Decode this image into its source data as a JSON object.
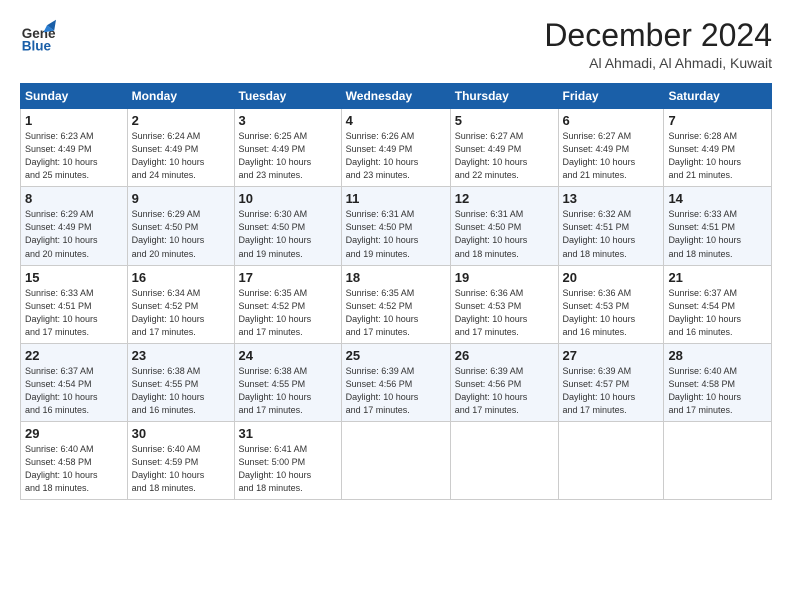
{
  "logo": {
    "line1": "General",
    "line2": "Blue"
  },
  "title": "December 2024",
  "subtitle": "Al Ahmadi, Al Ahmadi, Kuwait",
  "days_of_week": [
    "Sunday",
    "Monday",
    "Tuesday",
    "Wednesday",
    "Thursday",
    "Friday",
    "Saturday"
  ],
  "weeks": [
    [
      {
        "day": "1",
        "sunrise": "6:23 AM",
        "sunset": "4:49 PM",
        "daylight": "10 hours and 25 minutes."
      },
      {
        "day": "2",
        "sunrise": "6:24 AM",
        "sunset": "4:49 PM",
        "daylight": "10 hours and 24 minutes."
      },
      {
        "day": "3",
        "sunrise": "6:25 AM",
        "sunset": "4:49 PM",
        "daylight": "10 hours and 23 minutes."
      },
      {
        "day": "4",
        "sunrise": "6:26 AM",
        "sunset": "4:49 PM",
        "daylight": "10 hours and 23 minutes."
      },
      {
        "day": "5",
        "sunrise": "6:27 AM",
        "sunset": "4:49 PM",
        "daylight": "10 hours and 22 minutes."
      },
      {
        "day": "6",
        "sunrise": "6:27 AM",
        "sunset": "4:49 PM",
        "daylight": "10 hours and 21 minutes."
      },
      {
        "day": "7",
        "sunrise": "6:28 AM",
        "sunset": "4:49 PM",
        "daylight": "10 hours and 21 minutes."
      }
    ],
    [
      {
        "day": "8",
        "sunrise": "6:29 AM",
        "sunset": "4:49 PM",
        "daylight": "10 hours and 20 minutes."
      },
      {
        "day": "9",
        "sunrise": "6:29 AM",
        "sunset": "4:50 PM",
        "daylight": "10 hours and 20 minutes."
      },
      {
        "day": "10",
        "sunrise": "6:30 AM",
        "sunset": "4:50 PM",
        "daylight": "10 hours and 19 minutes."
      },
      {
        "day": "11",
        "sunrise": "6:31 AM",
        "sunset": "4:50 PM",
        "daylight": "10 hours and 19 minutes."
      },
      {
        "day": "12",
        "sunrise": "6:31 AM",
        "sunset": "4:50 PM",
        "daylight": "10 hours and 18 minutes."
      },
      {
        "day": "13",
        "sunrise": "6:32 AM",
        "sunset": "4:51 PM",
        "daylight": "10 hours and 18 minutes."
      },
      {
        "day": "14",
        "sunrise": "6:33 AM",
        "sunset": "4:51 PM",
        "daylight": "10 hours and 18 minutes."
      }
    ],
    [
      {
        "day": "15",
        "sunrise": "6:33 AM",
        "sunset": "4:51 PM",
        "daylight": "10 hours and 17 minutes."
      },
      {
        "day": "16",
        "sunrise": "6:34 AM",
        "sunset": "4:52 PM",
        "daylight": "10 hours and 17 minutes."
      },
      {
        "day": "17",
        "sunrise": "6:35 AM",
        "sunset": "4:52 PM",
        "daylight": "10 hours and 17 minutes."
      },
      {
        "day": "18",
        "sunrise": "6:35 AM",
        "sunset": "4:52 PM",
        "daylight": "10 hours and 17 minutes."
      },
      {
        "day": "19",
        "sunrise": "6:36 AM",
        "sunset": "4:53 PM",
        "daylight": "10 hours and 17 minutes."
      },
      {
        "day": "20",
        "sunrise": "6:36 AM",
        "sunset": "4:53 PM",
        "daylight": "10 hours and 16 minutes."
      },
      {
        "day": "21",
        "sunrise": "6:37 AM",
        "sunset": "4:54 PM",
        "daylight": "10 hours and 16 minutes."
      }
    ],
    [
      {
        "day": "22",
        "sunrise": "6:37 AM",
        "sunset": "4:54 PM",
        "daylight": "10 hours and 16 minutes."
      },
      {
        "day": "23",
        "sunrise": "6:38 AM",
        "sunset": "4:55 PM",
        "daylight": "10 hours and 16 minutes."
      },
      {
        "day": "24",
        "sunrise": "6:38 AM",
        "sunset": "4:55 PM",
        "daylight": "10 hours and 17 minutes."
      },
      {
        "day": "25",
        "sunrise": "6:39 AM",
        "sunset": "4:56 PM",
        "daylight": "10 hours and 17 minutes."
      },
      {
        "day": "26",
        "sunrise": "6:39 AM",
        "sunset": "4:56 PM",
        "daylight": "10 hours and 17 minutes."
      },
      {
        "day": "27",
        "sunrise": "6:39 AM",
        "sunset": "4:57 PM",
        "daylight": "10 hours and 17 minutes."
      },
      {
        "day": "28",
        "sunrise": "6:40 AM",
        "sunset": "4:58 PM",
        "daylight": "10 hours and 17 minutes."
      }
    ],
    [
      {
        "day": "29",
        "sunrise": "6:40 AM",
        "sunset": "4:58 PM",
        "daylight": "10 hours and 18 minutes."
      },
      {
        "day": "30",
        "sunrise": "6:40 AM",
        "sunset": "4:59 PM",
        "daylight": "10 hours and 18 minutes."
      },
      {
        "day": "31",
        "sunrise": "6:41 AM",
        "sunset": "5:00 PM",
        "daylight": "10 hours and 18 minutes."
      },
      null,
      null,
      null,
      null
    ]
  ]
}
